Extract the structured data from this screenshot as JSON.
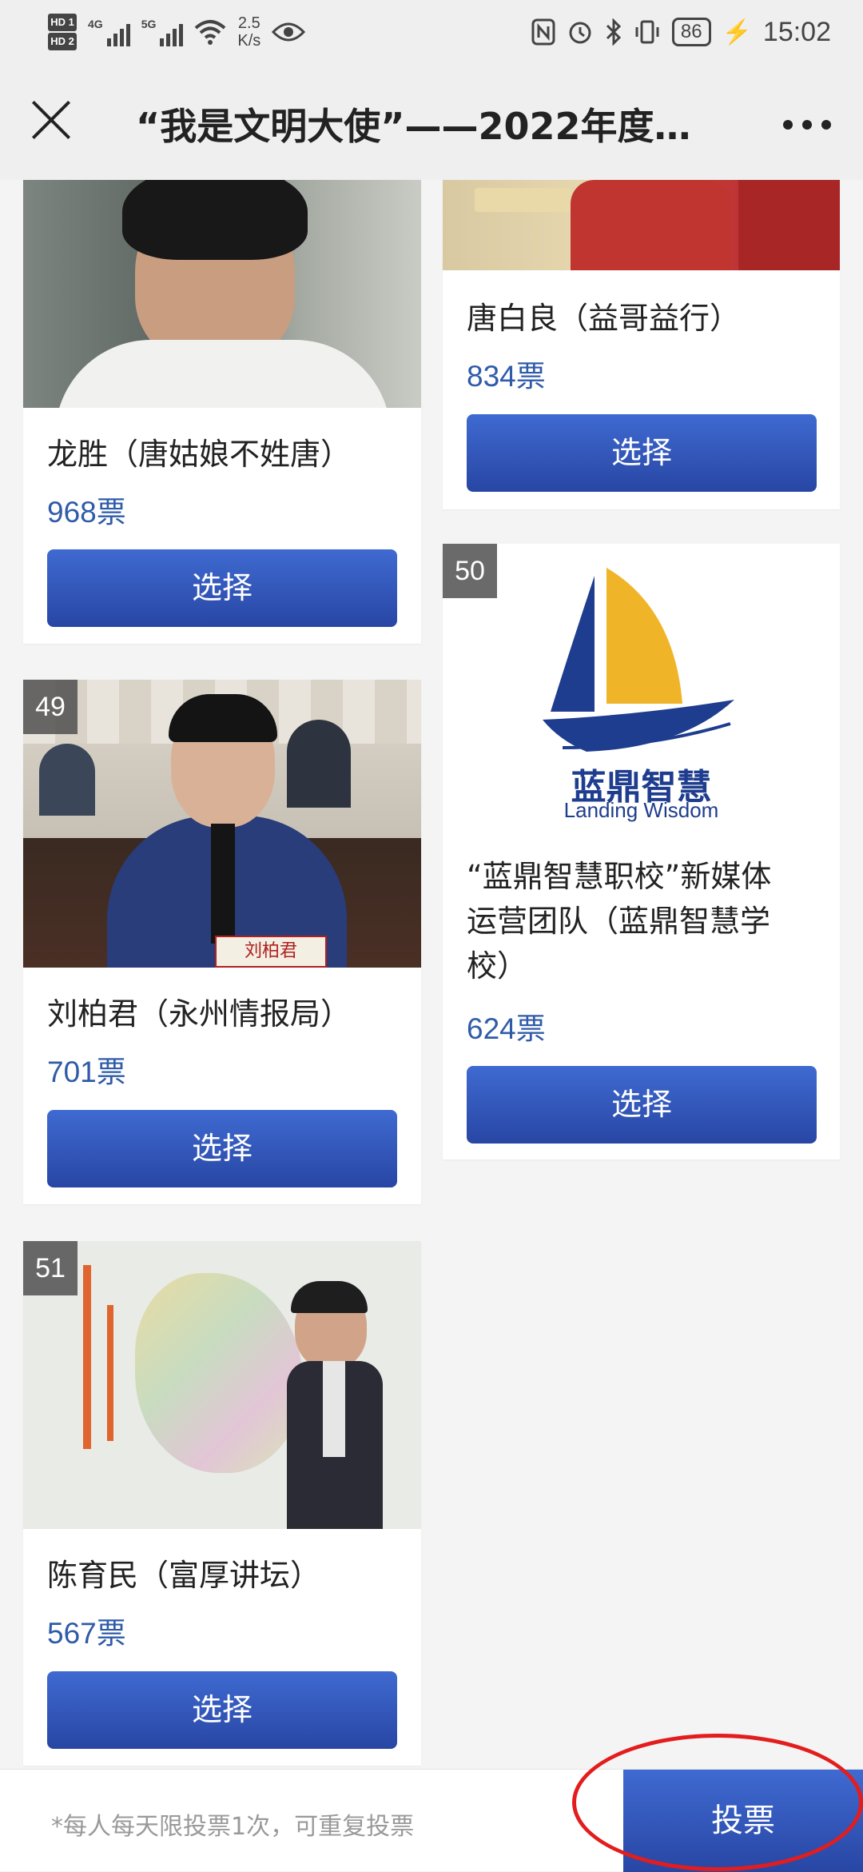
{
  "status_bar": {
    "hd1": "HD 1",
    "hd2": "HD 2",
    "net1": "4G",
    "net2": "5G",
    "speed_value": "2.5",
    "speed_unit": "K/s",
    "battery": "86",
    "time": "15:02"
  },
  "nav": {
    "title": "“我是文明大使”——2022年度…"
  },
  "cards": [
    {
      "name": "龙胜（唐姑娘不姓唐）",
      "votes": "968票",
      "button": "选择"
    },
    {
      "number": "49",
      "name": "刘柏君（永州情报局）",
      "votes": "701票",
      "button": "选择",
      "nameplate": "刘柏君"
    },
    {
      "number": "51",
      "name": "陈育民（富厚讲坛）",
      "votes": "567票",
      "button": "选择"
    },
    {
      "name": "唐白良（益哥益行）",
      "votes": "834票",
      "button": "选择"
    },
    {
      "number": "50",
      "name_line1": "“蓝鼎智慧职校”新媒体",
      "name_line2": "运营团队（蓝鼎智慧学",
      "name_line3": "校）",
      "votes": "624票",
      "button": "选择",
      "logo_cn": "蓝鼎智慧",
      "logo_en": "Landing Wisdom"
    }
  ],
  "bottom": {
    "note": "*每人每天限投票1次，可重复投票",
    "vote_button": "投票"
  },
  "colors": {
    "accent": "#2f5ba8",
    "button_top": "#3f6ad1",
    "button_bottom": "#2846a4",
    "highlight_circle": "#e31d1d"
  }
}
